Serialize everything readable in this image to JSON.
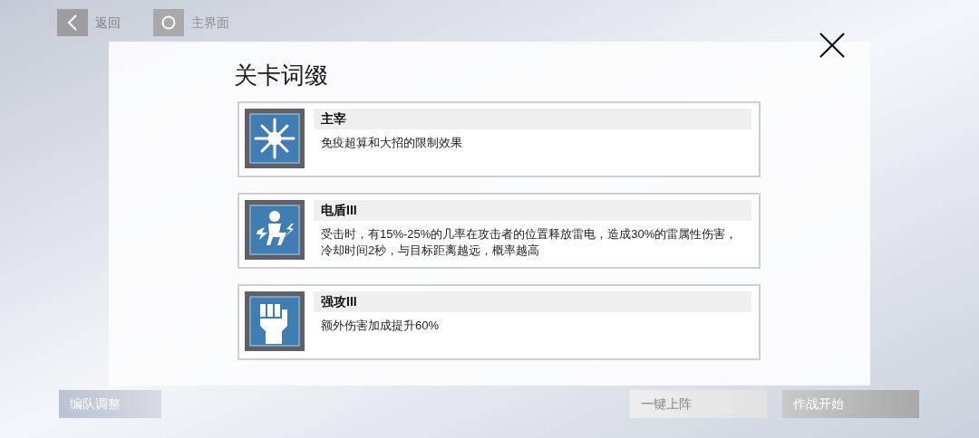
{
  "top_bar": {
    "back_button": "返回",
    "home_button": "主界面"
  },
  "dialog": {
    "title": "关卡词缀",
    "affixes": [
      {
        "kind": "burst",
        "name": "主宰",
        "description": "免疫超算和大招的限制效果"
      },
      {
        "kind": "shock",
        "name": "电盾III",
        "description": "受击时，有15%-25%的几率在攻击者的位置释放雷电，造成30%的雷属性伤害，冷却时间2秒，与目标距离越远，概率越高"
      },
      {
        "kind": "fist",
        "name": "强攻III",
        "description": "额外伤害加成提升60%"
      }
    ]
  },
  "bottom_bar": {
    "buttons": [
      {
        "kind": "team",
        "label": "编队调整"
      },
      {
        "kind": "light",
        "label": "一键上阵"
      },
      {
        "kind": "dark",
        "label": "作战开始"
      }
    ]
  }
}
